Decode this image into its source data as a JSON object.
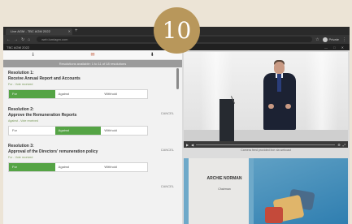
{
  "badge": {
    "number": "10"
  },
  "browser": {
    "tab_title": "Live AGM - TBC AGM 2022",
    "new_tab": "+",
    "url": "web.lumiagm.com",
    "profile_label": "Private",
    "app_title": "TBC AGM 2022",
    "window_controls": "— □ ✕"
  },
  "toolstrip": {
    "info": "ℹ",
    "messages": "✉",
    "download": "⬇"
  },
  "voting": {
    "header": "Resolutions available: 1 to 11 of 18 resolutions",
    "resolutions": [
      {
        "number": "Resolution 1:",
        "title": "Receive Annual Report and Accounts",
        "status": "For - Vote received",
        "options": [
          "For",
          "Against",
          "Withhold"
        ],
        "selected": 0,
        "cancel": "CANCEL"
      },
      {
        "number": "Resolution 2:",
        "title": "Approve the Remuneration Reports",
        "status": "Against - Vote received",
        "options": [
          "For",
          "Against",
          "Withhold"
        ],
        "selected": 1,
        "cancel": "CANCEL"
      },
      {
        "number": "Resolution 3:",
        "title": "Approval of the Directors' remuneration policy",
        "status": "For - Vote received",
        "options": [
          "For",
          "Against",
          "Withhold"
        ],
        "selected": 0,
        "cancel": "CANCEL"
      }
    ]
  },
  "video": {
    "caption": "Camera feed provided live via webcast",
    "brand_name": "ARCHIE NORMAN",
    "brand_sub": "Chairman"
  },
  "colors": {
    "vote_selected": "#55a445",
    "badge": "#b8975b"
  }
}
